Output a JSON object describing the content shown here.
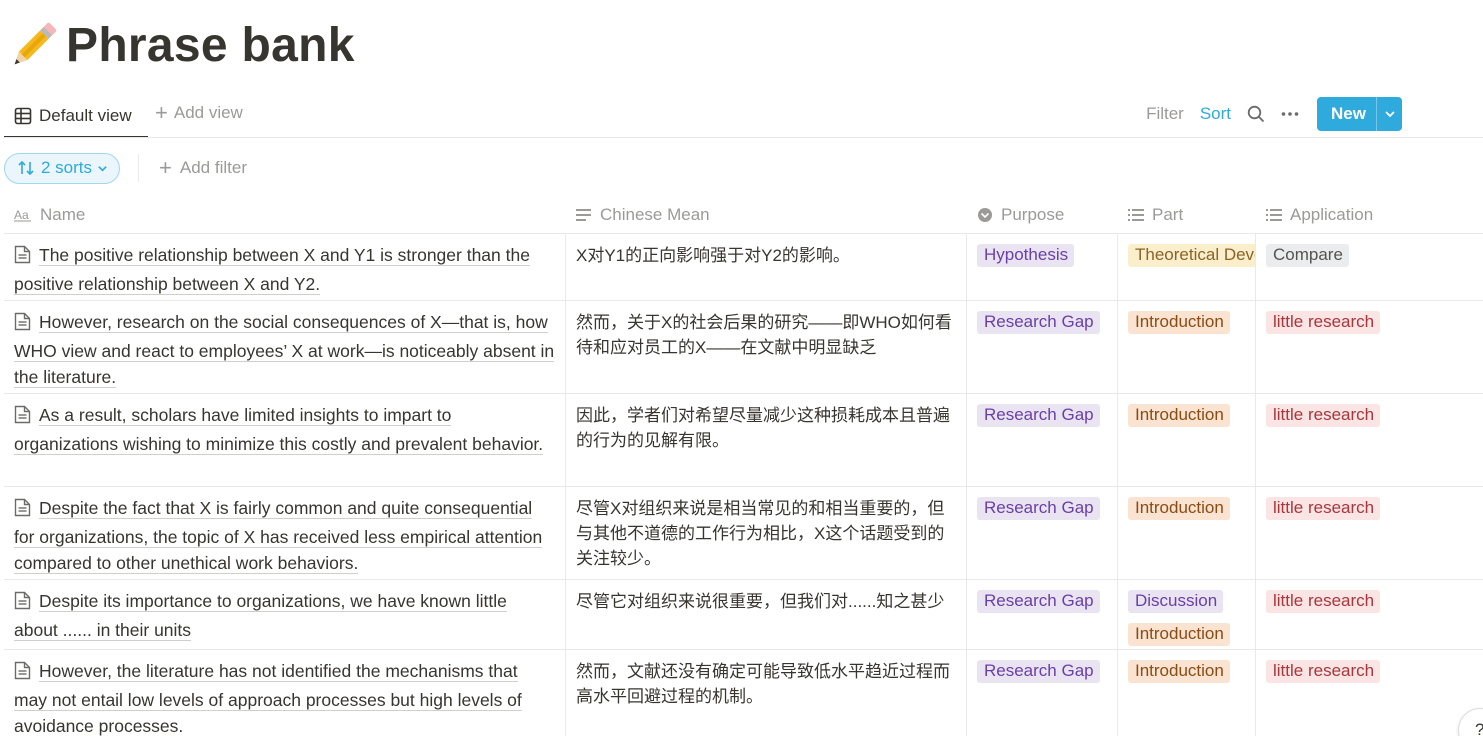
{
  "page": {
    "title": "Phrase bank",
    "icon": "pencil-icon"
  },
  "views": {
    "default_label": "Default view",
    "add_view_label": "Add view",
    "filter_label": "Filter",
    "sort_label": "Sort",
    "new_label": "New"
  },
  "sortbar": {
    "sorts_label": "2 sorts",
    "add_filter_label": "Add filter"
  },
  "columns": {
    "name": "Name",
    "chinese": "Chinese Mean",
    "purpose": "Purpose",
    "part": "Part",
    "application": "Application"
  },
  "tag_colors": {
    "purple": {
      "bg": "#eae4f2",
      "fg": "#6940a5"
    },
    "orange": {
      "bg": "#fae3d0",
      "fg": "#8a4c15"
    },
    "yellow": {
      "bg": "#fbeecb",
      "fg": "#89632a"
    },
    "red": {
      "bg": "#fbe4e4",
      "fg": "#a8373c"
    },
    "gray": {
      "bg": "#ebeced",
      "fg": "#55534e"
    }
  },
  "rows": [
    {
      "name": "The positive relationship between X and Y1 is stronger than the positive relationship between X and Y2.",
      "chinese": "X对Y1的正向影响强于对Y2的影响。",
      "purpose": "Hypothesis",
      "part": [
        "Theoretical Development"
      ],
      "application": "Compare"
    },
    {
      "name": "However, research on the social consequences of X—that is, how WHO view and react to employees’ X at work—is noticeably absent in the literature.",
      "chinese": "然而，关于X的社会后果的研究——即WHO如何看待和应对员工的X——在文献中明显缺乏",
      "purpose": "Research Gap",
      "part": [
        "Introduction"
      ],
      "application": "little research"
    },
    {
      "name": "As a result, scholars have limited insights to impart to organizations wishing to minimize this costly and prevalent behavior.",
      "chinese": "因此，学者们对希望尽量减少这种损耗成本且普遍的行为的见解有限。",
      "purpose": "Research Gap",
      "part": [
        "Introduction"
      ],
      "application": "little research"
    },
    {
      "name": "Despite the fact that X is fairly common and quite consequential for organizations, the topic of X has received less empirical attention compared to other unethical work behaviors.",
      "chinese": "尽管X对组织来说是相当常见的和相当重要的，但与其他不道德的工作行为相比，X这个话题受到的关注较少。",
      "purpose": "Research Gap",
      "part": [
        "Introduction"
      ],
      "application": "little research"
    },
    {
      "name": "Despite its importance to organizations, we have known little about ...... in their units",
      "chinese": "尽管它对组织来说很重要，但我们对......知之甚少",
      "purpose": "Research Gap",
      "part": [
        "Discussion",
        "Introduction"
      ],
      "application": "little research"
    },
    {
      "name": "However, the literature has not identified the mechanisms that may not entail low levels of approach processes but high levels of avoidance processes.",
      "chinese": "然而，文献还没有确定可能导致低水平趋近过程而高水平回避过程的机制。",
      "purpose": "Research Gap",
      "part": [
        "Introduction"
      ],
      "application": "little research"
    }
  ],
  "help_label": "?"
}
